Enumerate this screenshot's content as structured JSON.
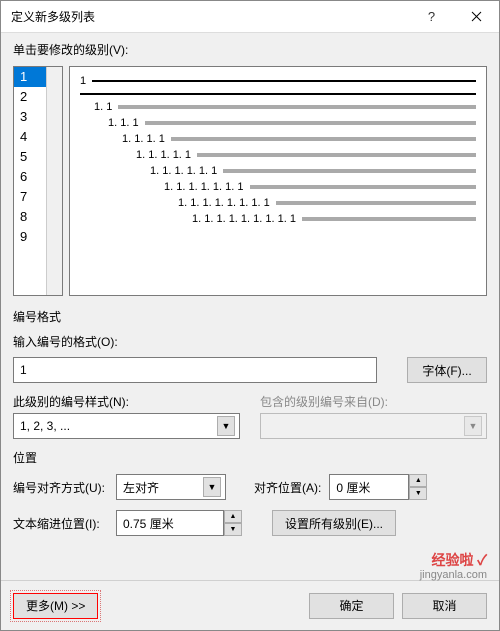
{
  "title": "定义新多级列表",
  "labels": {
    "click_level": "单击要修改的级别(V):",
    "number_format_group": "编号格式",
    "enter_format": "输入编号的格式(O):",
    "font_btn": "字体(F)...",
    "this_level_style": "此级别的编号样式(N):",
    "include_from": "包含的级别编号来自(D):",
    "position_group": "位置",
    "align": "编号对齐方式(U):",
    "align_at": "对齐位置(A):",
    "text_indent": "文本缩进位置(I):",
    "set_all": "设置所有级别(E)...",
    "more": "更多(M) >>",
    "ok": "确定",
    "cancel": "取消"
  },
  "levels": [
    "1",
    "2",
    "3",
    "4",
    "5",
    "6",
    "7",
    "8",
    "9"
  ],
  "selected_level_index": 0,
  "preview": [
    {
      "num": "1",
      "bold": true,
      "indent": 0
    },
    {
      "num": "",
      "bold": true,
      "indent": 0
    },
    {
      "num": "1. 1",
      "bold": false,
      "indent": 1
    },
    {
      "num": "1. 1. 1",
      "bold": false,
      "indent": 2
    },
    {
      "num": "1. 1. 1. 1",
      "bold": false,
      "indent": 3
    },
    {
      "num": "1. 1. 1. 1. 1",
      "bold": false,
      "indent": 4
    },
    {
      "num": "1. 1. 1. 1. 1. 1",
      "bold": false,
      "indent": 5
    },
    {
      "num": "1. 1. 1. 1. 1. 1. 1",
      "bold": false,
      "indent": 6
    },
    {
      "num": "1. 1. 1. 1. 1. 1. 1. 1",
      "bold": false,
      "indent": 7
    },
    {
      "num": "1. 1. 1. 1. 1. 1. 1. 1. 1",
      "bold": false,
      "indent": 8
    }
  ],
  "format_value": "1",
  "style_select": "1, 2, 3, ...",
  "include_select": "",
  "align_select": "左对齐",
  "align_at_value": "0 厘米",
  "indent_value": "0.75 厘米",
  "watermark": {
    "top": "经验啦 ✓",
    "bottom": "jingyanla.com"
  }
}
